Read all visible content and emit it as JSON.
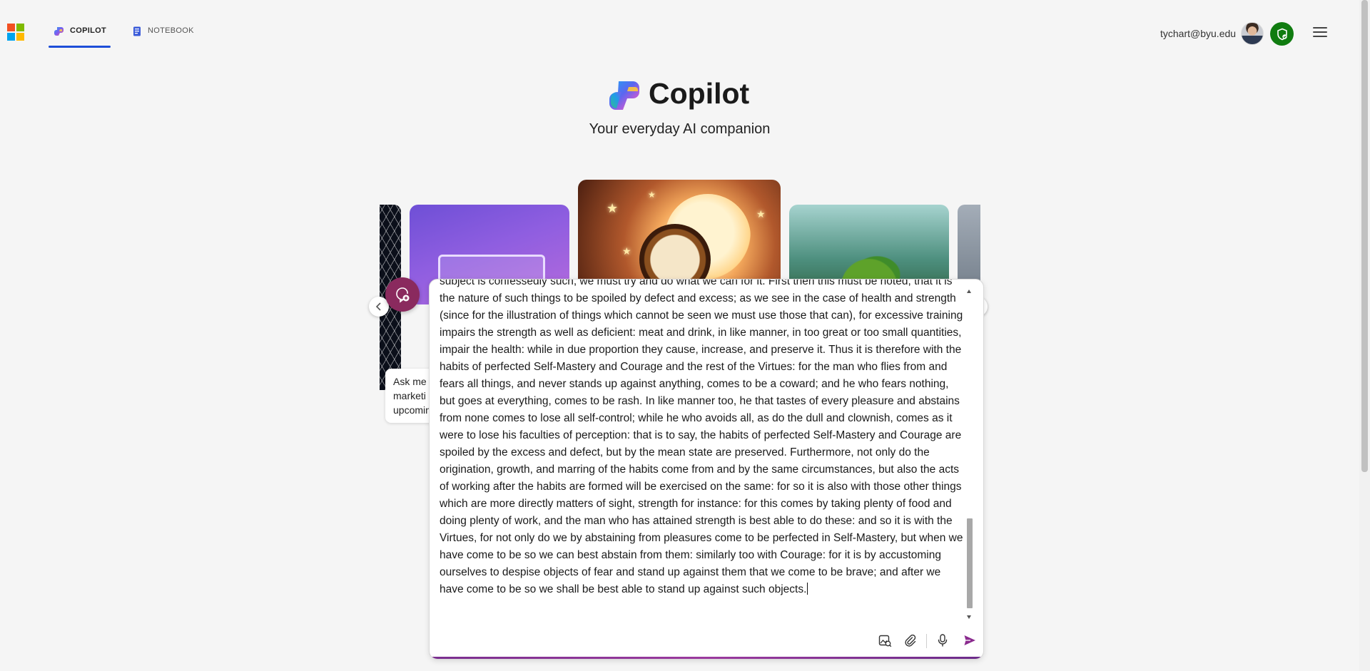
{
  "header": {
    "tabs": [
      {
        "label": "COPILOT",
        "active": true
      },
      {
        "label": "NOTEBOOK",
        "active": false
      }
    ],
    "user_email": "tychart@byu.edu",
    "colors": {
      "active_tab_underline": "#1d4ed8",
      "shield_green": "#107c10"
    }
  },
  "hero": {
    "title": "Copilot",
    "subtitle": "Your everyday AI companion"
  },
  "carousel": {
    "prompt_card_text": [
      "Ask me",
      "marketi",
      "upcomin"
    ]
  },
  "composer": {
    "text": "subject is confessedly such, we must try and do what we can for it. First then this must be noted, that it is the nature of such things to be spoiled by defect and excess; as we see in the case of health and strength (since for the illustration of things which cannot be seen we must use those that can), for excessive training impairs the strength as well as deficient: meat and drink, in like manner, in too great or too small quantities, impair the health: while in due proportion they cause, increase, and preserve it. Thus it is therefore with the habits of perfected Self-Mastery and Courage and the rest of the Virtues: for the man who flies from and fears all things, and never stands up against anything, comes to be a coward; and he who fears nothing, but goes at everything, comes to be rash. In like manner too, he that tastes of every pleasure and abstains from none comes to lose all self-control; while he who avoids all, as do the dull and clownish, comes as it were to lose his faculties of perception: that is to say, the habits of perfected Self-Mastery and Courage are spoiled by the excess and defect, but by the mean state are preserved. Furthermore, not only do the origination, growth, and marring of the habits come from and by the same circumstances, but also the acts of working after the habits are formed will be exercised on the same: for so it is also with those other things which are more directly matters of sight, strength for instance: for this comes by taking plenty of food and doing plenty of work, and the man who has attained strength is best able to do these: and so it is with the Virtues, for not only do we by abstaining from pleasures come to be perfected in Self-Mastery, but when we have come to be so we can best abstain from them: similarly too with Courage: for it is by accustoming ourselves to despise objects of fear and stand up against them that we come to be brave; and after we have come to be so we shall be best able to stand up against such objects.",
    "accent_color": "#7a2f8f",
    "tools": [
      "image-search-icon",
      "paperclip-icon",
      "microphone-icon",
      "send-icon"
    ]
  }
}
